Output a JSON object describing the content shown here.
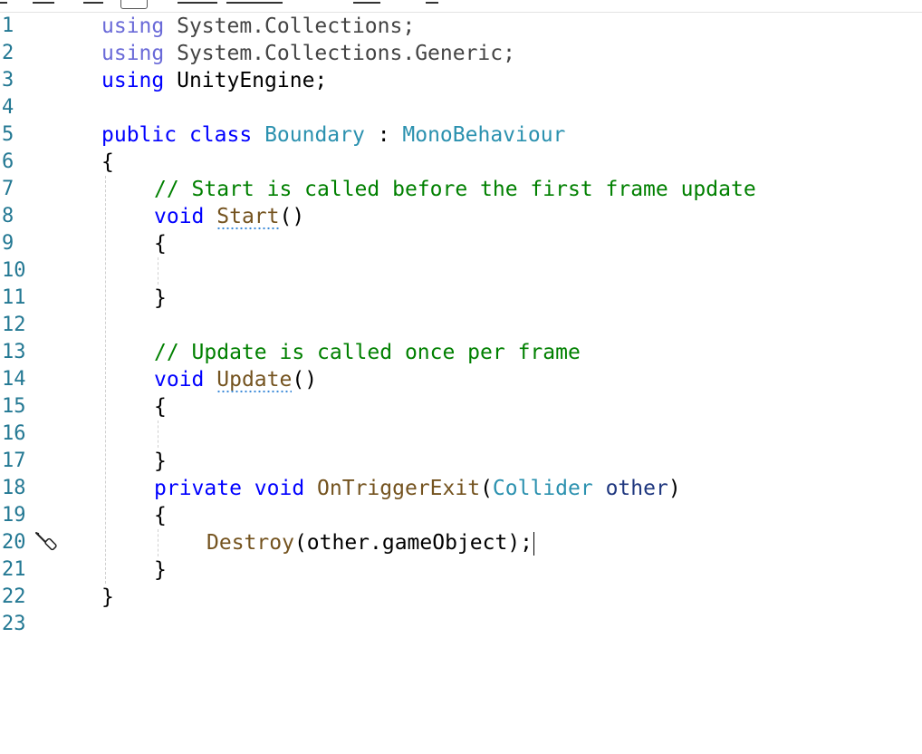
{
  "line_numbers": [
    "1",
    "2",
    "3",
    "4",
    "5",
    "6",
    "7",
    "8",
    "9",
    "10",
    "11",
    "12",
    "13",
    "14",
    "15",
    "16",
    "17",
    "18",
    "19",
    "20",
    "21",
    "22",
    "23"
  ],
  "code": {
    "l1_kw": "using",
    "l1_ns": " System.Collections;",
    "l2_kw": "using",
    "l2_ns": " System.Collections.Generic;",
    "l3_kw": "using",
    "l3_ns": " UnityEngine;",
    "l5_kw1": "public",
    "l5_kw2": "class",
    "l5_type": "Boundary",
    "l5_colon": " : ",
    "l5_base": "MonoBehaviour",
    "l6": "{",
    "l7_comment": "// Start is called before the first frame update",
    "l8_kw": "void",
    "l8_method": "Start",
    "l8_parens": "()",
    "l9": "{",
    "l11": "}",
    "l13_comment": "// Update is called once per frame",
    "l14_kw": "void",
    "l14_method": "Update",
    "l14_parens": "()",
    "l15": "{",
    "l17": "}",
    "l18_kw1": "private",
    "l18_kw2": "void",
    "l18_method": "OnTriggerExit",
    "l18_open": "(",
    "l18_type": "Collider",
    "l18_param": "other",
    "l18_close": ")",
    "l19": "{",
    "l20_method": "Destroy",
    "l20_args": "(other.gameObject);",
    "l21": "}",
    "l22": "}"
  },
  "colors": {
    "keyword": "#0000ff",
    "type": "#2b91af",
    "method": "#74531f",
    "parameter": "#1f377f",
    "comment": "#008000",
    "line_number": "#237893"
  },
  "icons": {
    "gutter_line_20": "screwdriver-icon"
  }
}
